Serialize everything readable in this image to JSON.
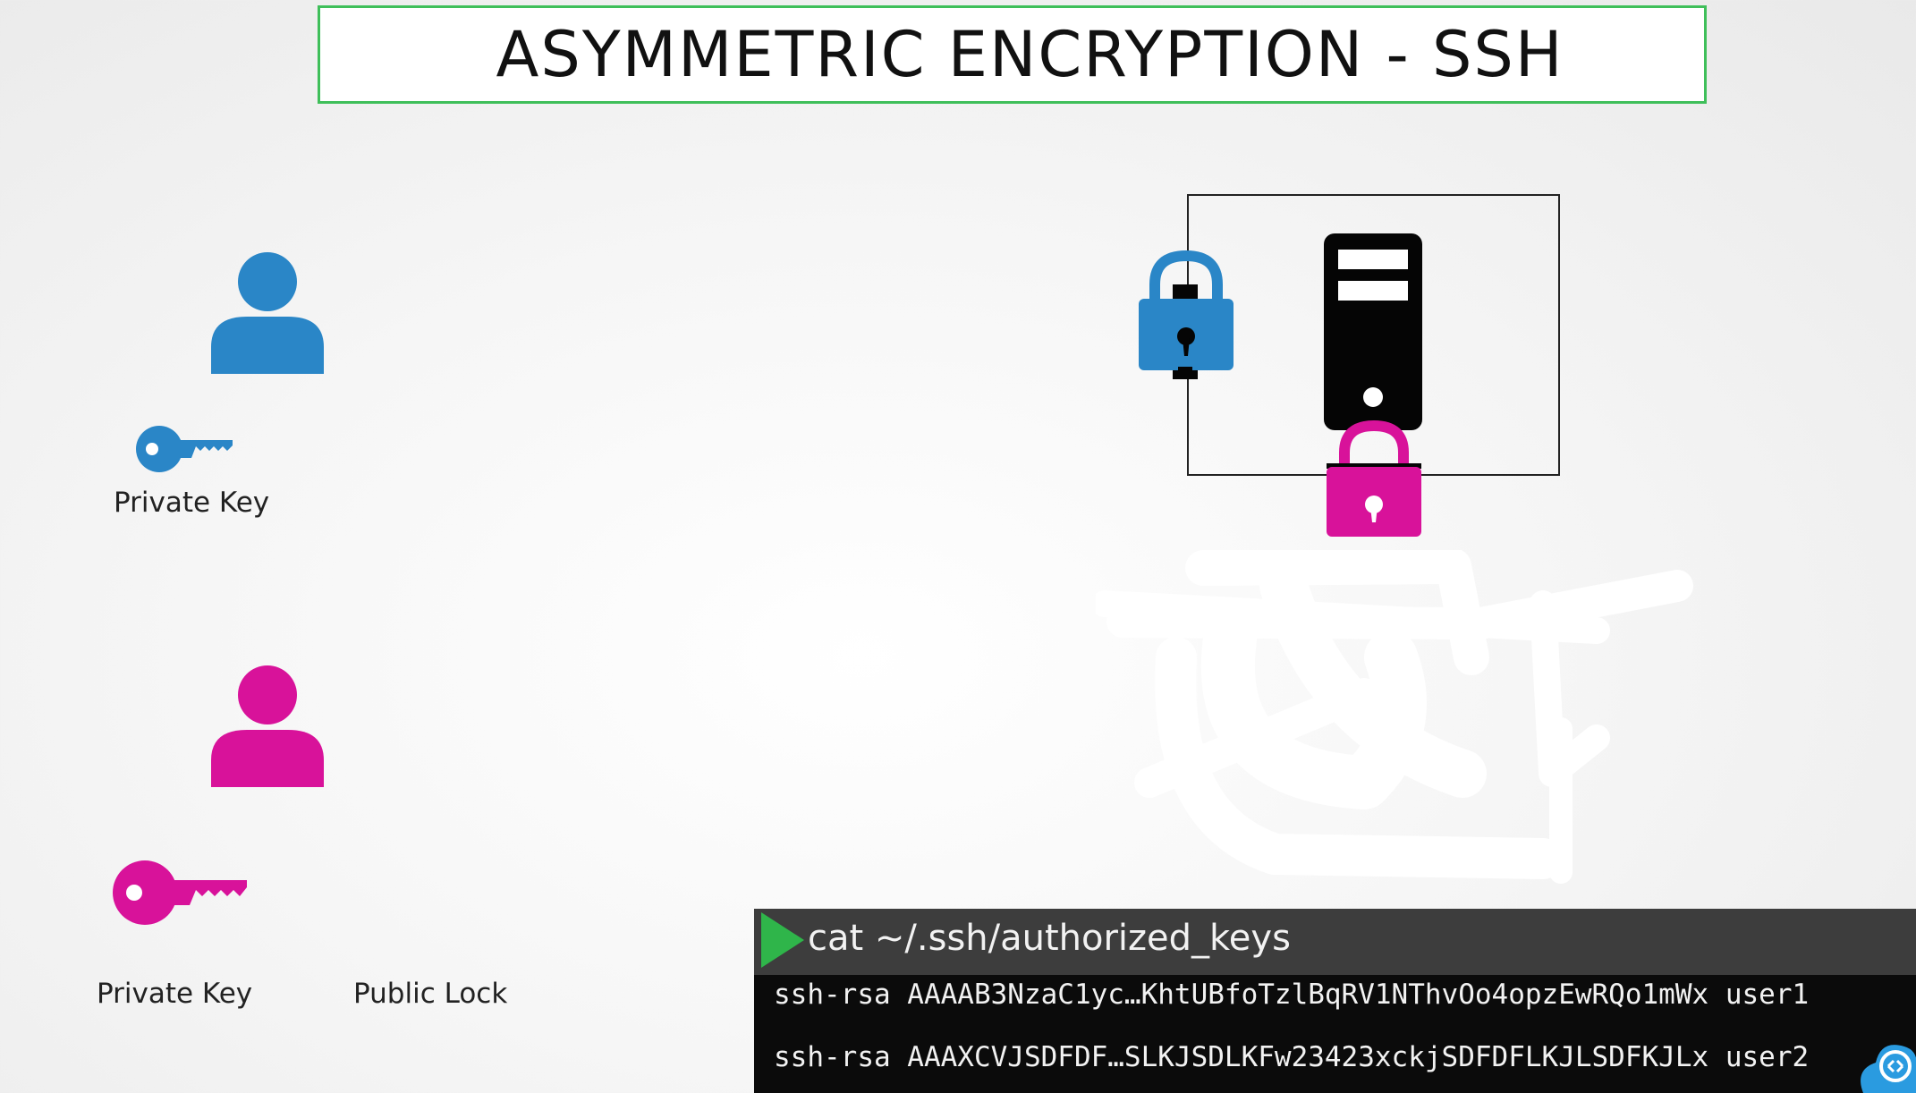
{
  "title": "ASYMMETRIC ENCRYPTION - SSH",
  "users": [
    {
      "role": "user1",
      "color": "#2a86c7",
      "key_label": "Private Key"
    },
    {
      "role": "user2",
      "color": "#d8129a",
      "key_label": "Private Key",
      "lock_label": "Public Lock"
    }
  ],
  "server": {
    "icon": "server-icon",
    "locks": [
      {
        "color": "#2a86c7",
        "icon": "padlock-icon"
      },
      {
        "color": "#d8129a",
        "icon": "padlock-icon"
      }
    ]
  },
  "terminal": {
    "command": "cat ~/.ssh/authorized_keys",
    "lines": [
      "ssh-rsa AAAAB3NzaC1yc…KhtUBfoTzlBqRV1NThvOo4opzEwRQo1mWx user1",
      "ssh-rsa AAAXCVJSDFDF…SLKJSDLKFw23423xckjSDFDFLKJLSDFKJLx user2"
    ]
  },
  "colors": {
    "title_border": "#3fbf5a",
    "blue": "#2a86c7",
    "pink": "#d8129a",
    "terminal_bg": "#0b0b0b",
    "terminal_header": "#3d3d3d",
    "prompt": "#2fb54a"
  }
}
